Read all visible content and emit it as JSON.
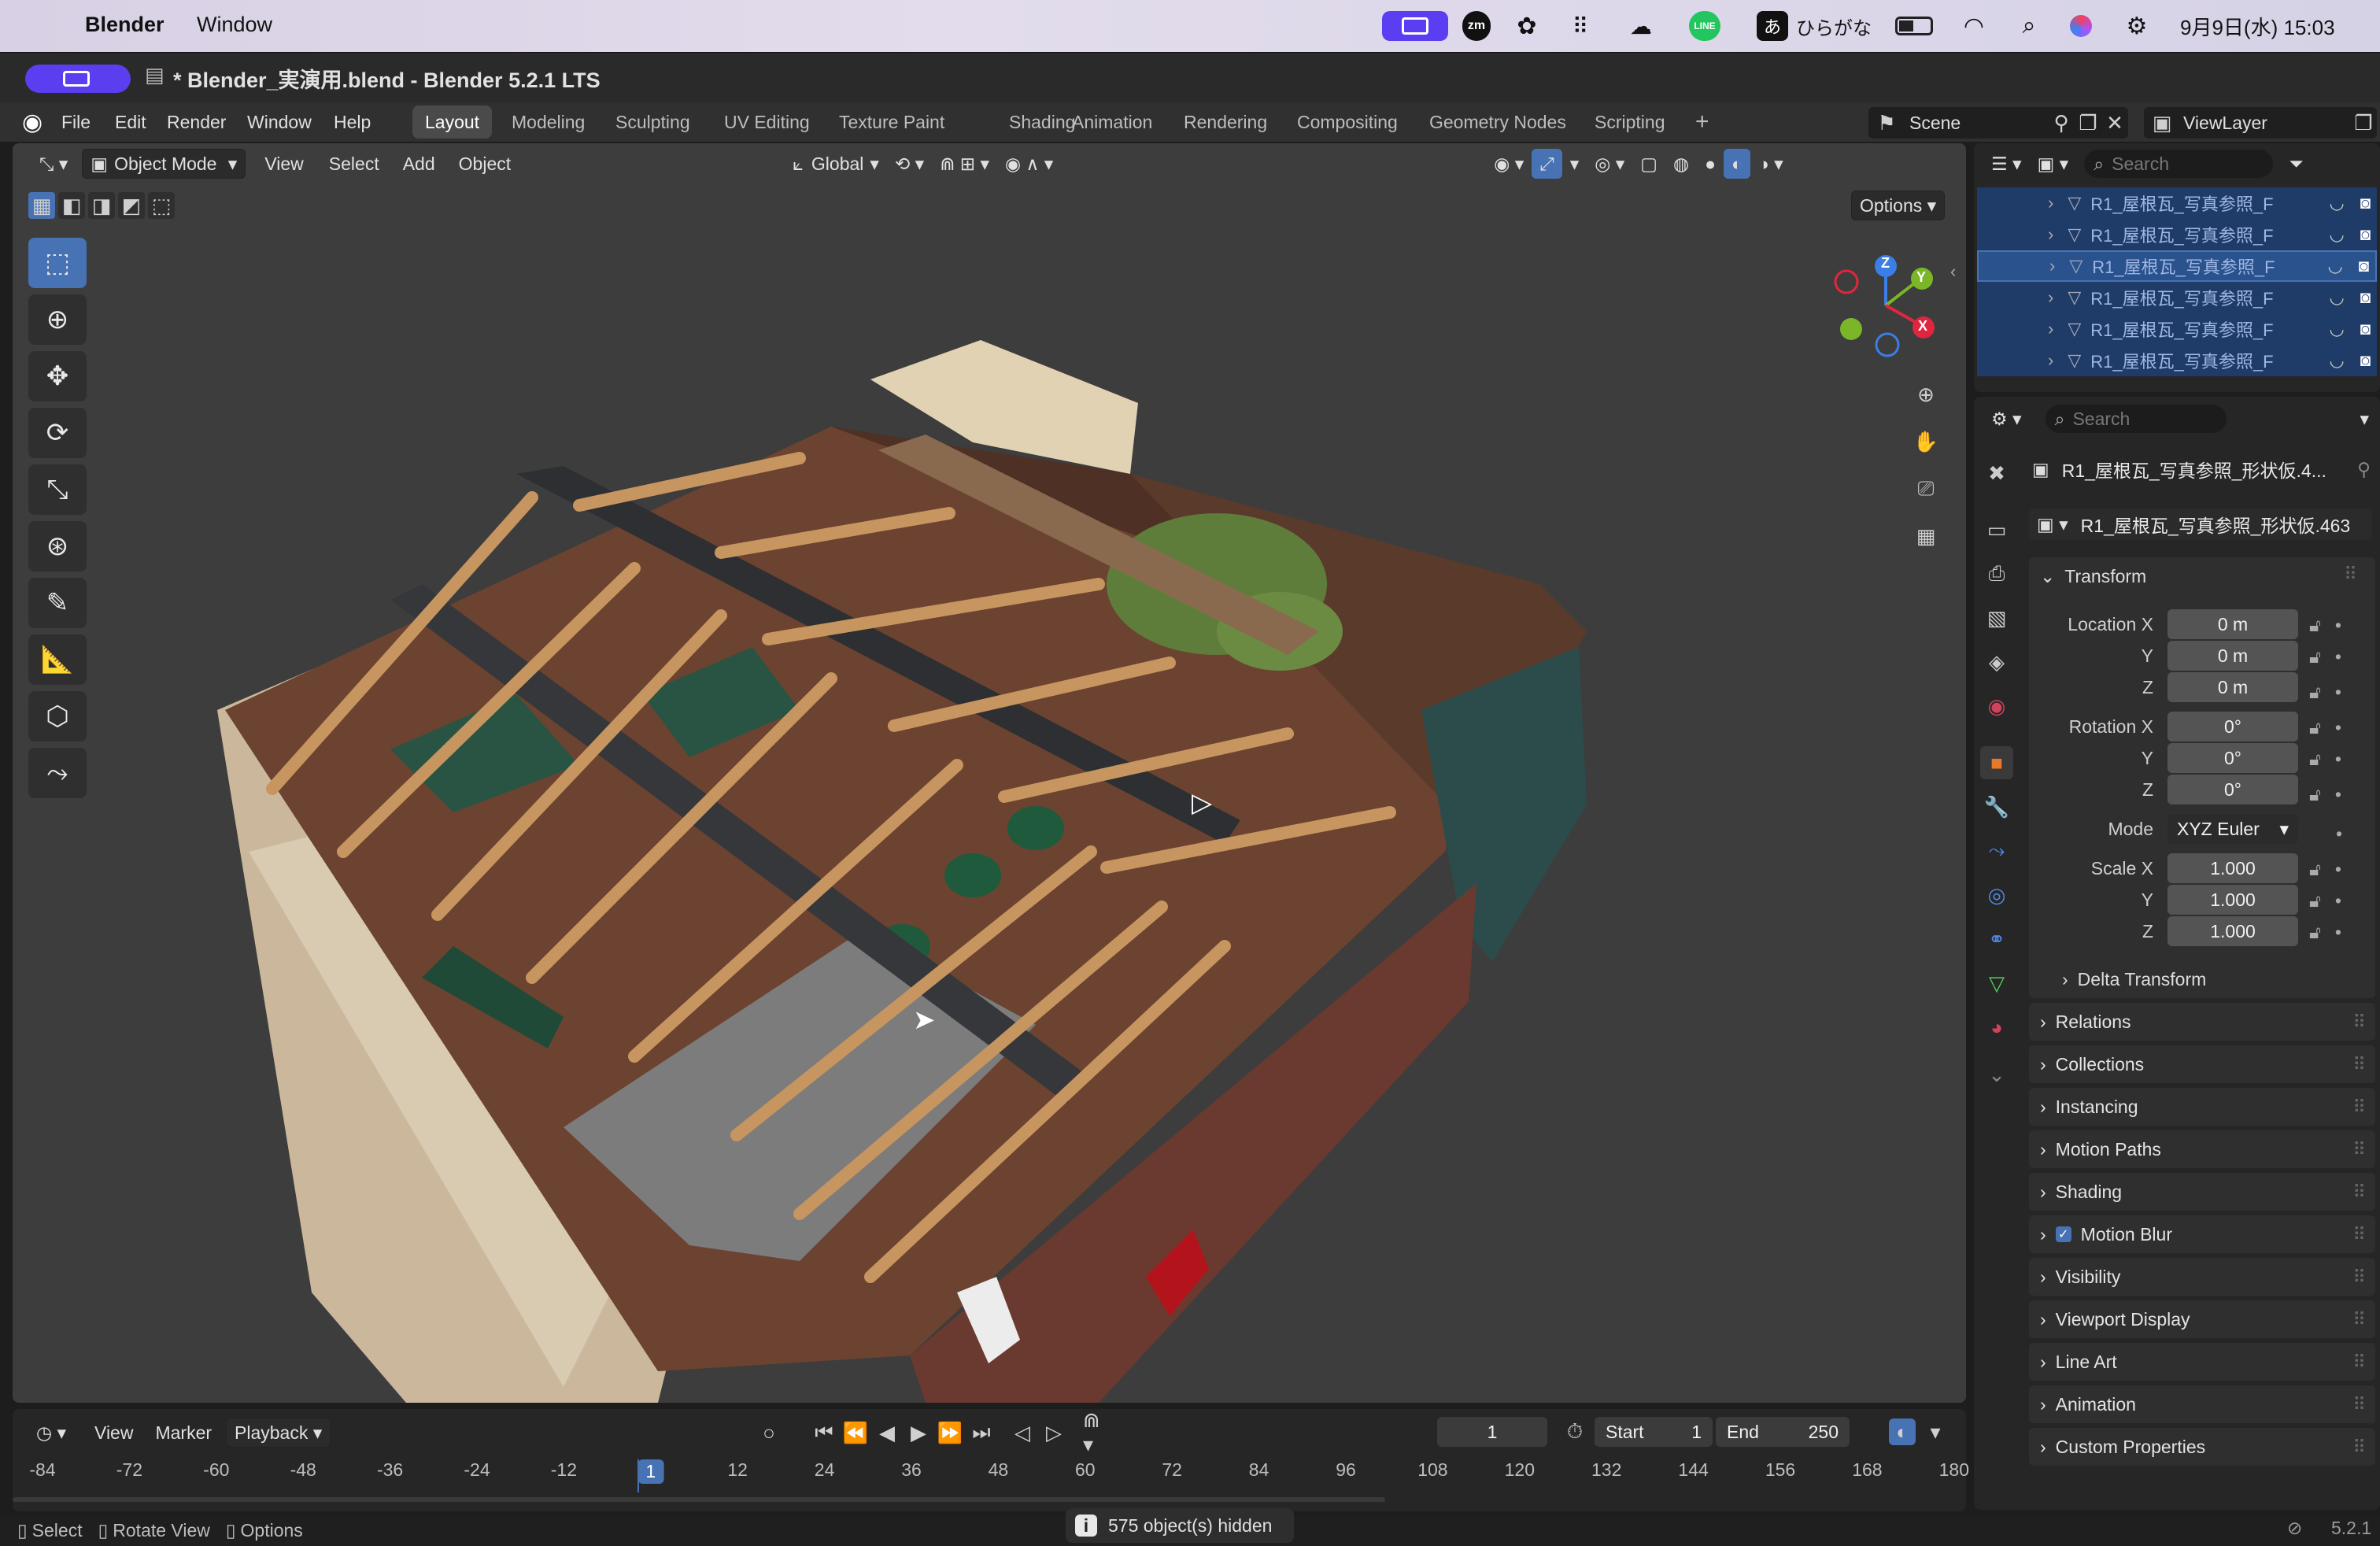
{
  "macos": {
    "app_name": "Blender",
    "menu_window": "Window",
    "ime_label": "ひらがな",
    "ime_prefix": "あ",
    "clock": "9月9日(水) 15:03",
    "zm": "zm",
    "line": "LINE"
  },
  "window": {
    "title": "* Blender_実演用.blend - Blender 5.2.1 LTS"
  },
  "menu": [
    "File",
    "Edit",
    "Render",
    "Window",
    "Help"
  ],
  "workspaces": {
    "tabs": [
      "Layout",
      "Modeling",
      "Sculpting",
      "UV Editing",
      "Texture Paint",
      "Shading",
      "Animation",
      "Rendering",
      "Compositing",
      "Geometry Nodes",
      "Scripting"
    ],
    "active": "Layout",
    "add_symbol": "+"
  },
  "scene": {
    "name": "Scene",
    "view_layer": "ViewLayer"
  },
  "viewport_header": {
    "mode": "Object Mode",
    "menus": [
      "View",
      "Select",
      "Add",
      "Object"
    ],
    "orientation": "Global",
    "options": "Options"
  },
  "gizmo": {
    "z": "Z",
    "y": "Y",
    "x": "X"
  },
  "outliner": {
    "search_placeholder": "Search",
    "rows": [
      "R1_屋根瓦_写真参照_F",
      "R1_屋根瓦_写真参照_F",
      "R1_屋根瓦_写真参照_F",
      "R1_屋根瓦_写真参照_F",
      "R1_屋根瓦_写真参照_F",
      "R1_屋根瓦_写真参照_F"
    ]
  },
  "properties": {
    "search_placeholder": "Search",
    "object_name": "R1_屋根瓦_写真参照_形状仮.4...",
    "data_name": "R1_屋根瓦_写真参照_形状仮.463",
    "transform_label": "Transform",
    "location": {
      "label": "Location X",
      "y": "Y",
      "z": "Z",
      "values": [
        "0 m",
        "0 m",
        "0 m"
      ]
    },
    "rotation": {
      "label": "Rotation X",
      "y": "Y",
      "z": "Z",
      "values": [
        "0°",
        "0°",
        "0°"
      ]
    },
    "mode": {
      "label": "Mode",
      "value": "XYZ Euler"
    },
    "scale": {
      "label": "Scale X",
      "y": "Y",
      "z": "Z",
      "values": [
        "1.000",
        "1.000",
        "1.000"
      ]
    },
    "delta_transform": "Delta Transform",
    "panels": [
      "Relations",
      "Collections",
      "Instancing",
      "Motion Paths",
      "Shading",
      "Motion Blur",
      "Visibility",
      "Viewport Display",
      "Line Art",
      "Animation",
      "Custom Properties"
    ],
    "motion_blur_checked": true
  },
  "timeline": {
    "menus": [
      "View",
      "Marker",
      "Playback"
    ],
    "current_frame": "1",
    "start_label": "Start",
    "start": "1",
    "end_label": "End",
    "end": "250",
    "ticks": [
      "-84",
      "-72",
      "-60",
      "-48",
      "-36",
      "-24",
      "-12",
      "1",
      "12",
      "24",
      "36",
      "48",
      "60",
      "72",
      "84",
      "96",
      "108",
      "120",
      "132",
      "144",
      "156",
      "168",
      "180"
    ]
  },
  "statusbar": {
    "select": "Select",
    "rotate_view": "Rotate View",
    "options": "Options",
    "hidden_message": "575 object(s) hidden",
    "version": "5.2.1"
  },
  "colors": {
    "accent": "#4772b3",
    "outliner_selected": "#1f3c68",
    "axis_x": "#e0263e",
    "axis_y": "#7ab628",
    "axis_z": "#3a7ee6"
  }
}
